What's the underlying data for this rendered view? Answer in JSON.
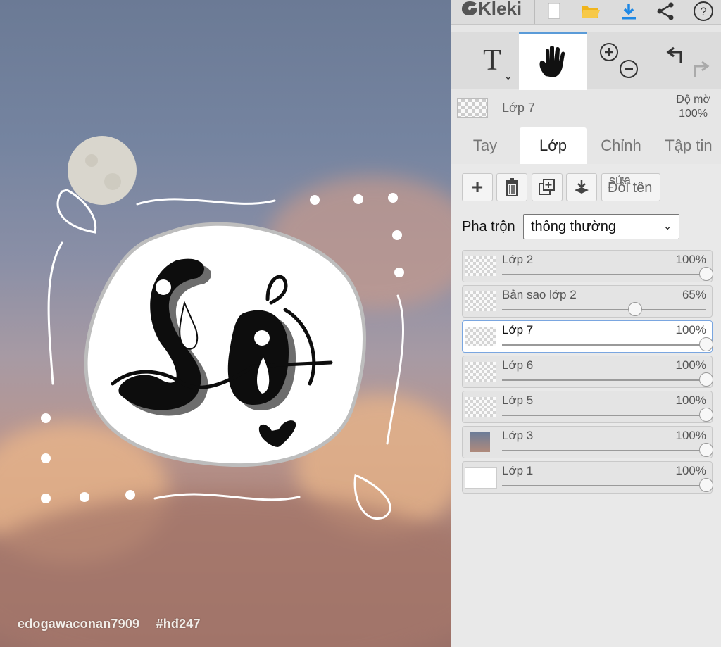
{
  "canvas": {
    "watermark_user": "edogawaconan7909",
    "watermark_tag": "#hđ247",
    "art_text": "Sợ"
  },
  "app": {
    "logo": "Kleki",
    "top_icons": [
      "new-file-icon",
      "open-folder-icon",
      "download-icon",
      "share-icon",
      "help-icon"
    ],
    "accent": "#1e88e5"
  },
  "toolbar": {
    "tools": [
      "text-tool-icon",
      "hand-tool-icon",
      "zoom-in-icon",
      "zoom-out-icon",
      "undo-icon",
      "redo-icon"
    ],
    "active_tool": "hand"
  },
  "current_layer": {
    "name": "Lớp 7",
    "opacity_label": "Độ mờ",
    "opacity_value": "100%"
  },
  "tabs": [
    {
      "label": "Tay",
      "active": false
    },
    {
      "label": "Lớp",
      "active": true
    },
    {
      "label": "Chỉnh",
      "active": false
    },
    {
      "label": "Tập tin",
      "active": false
    }
  ],
  "layer_buttons": {
    "add": "+",
    "rename_top": "sửa",
    "rename": "Đổi tên"
  },
  "blend": {
    "label": "Pha trộn",
    "value": "thông thường"
  },
  "layers": [
    {
      "name": "Lớp 2",
      "opacity": "100%",
      "level": 1.0,
      "selected": false
    },
    {
      "name": "Bản sao lớp 2",
      "opacity": "65%",
      "level": 0.65,
      "selected": false
    },
    {
      "name": "Lớp 7",
      "opacity": "100%",
      "level": 1.0,
      "selected": true
    },
    {
      "name": "Lớp 6",
      "opacity": "100%",
      "level": 1.0,
      "selected": false
    },
    {
      "name": "Lớp 5",
      "opacity": "100%",
      "level": 1.0,
      "selected": false
    },
    {
      "name": "Lớp 3",
      "opacity": "100%",
      "level": 1.0,
      "selected": false
    },
    {
      "name": "Lớp 1",
      "opacity": "100%",
      "level": 1.0,
      "selected": false
    }
  ]
}
